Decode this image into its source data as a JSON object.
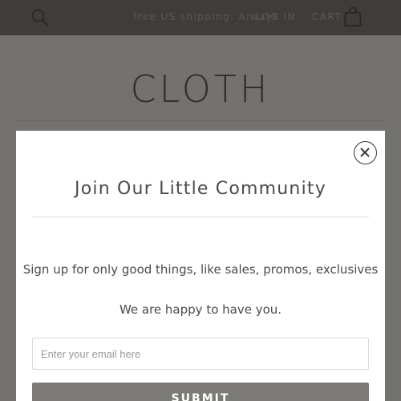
{
  "header": {
    "search_icon": "search-icon",
    "shipping_text": "free US shipping. Always",
    "login_label": "LOG IN",
    "cart_label": "CART",
    "cart_icon": "shopping-bag-icon"
  },
  "brand": {
    "logo_text": "CLOTH"
  },
  "popup": {
    "close_icon": "close-icon",
    "title": "Join Our Little Community",
    "description": "Sign up for only good things, like sales, promos, exclusives",
    "subtext": "We are happy to have you.",
    "email_placeholder": "Enter your email here",
    "email_value": "",
    "submit_label": "SUBMIT"
  },
  "colors": {
    "overlay": "#6f6d6b",
    "topbar": "#3e3d3b",
    "modal_bg": "#ffffff",
    "text_dark": "#4d4b48",
    "submit_bg": "#7d7b78"
  }
}
